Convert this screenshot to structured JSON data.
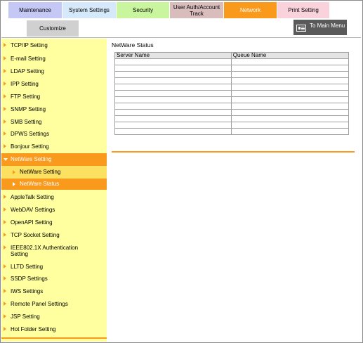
{
  "tabs": {
    "maintenance": "Maintenance",
    "system_settings": "System Settings",
    "security": "Security",
    "user_auth_line1": "User Auth/Account",
    "user_auth_line2": "Track",
    "network": "Network",
    "print_setting": "Print Setting",
    "customize": "Customize"
  },
  "main_menu_label": "To Main Menu",
  "sidebar": {
    "items": [
      "TCP/IP Setting",
      "E-mail Setting",
      "LDAP Setting",
      "IPP Setting",
      "FTP Setting",
      "SNMP Setting",
      "SMB Setting",
      "DPWS Settings",
      "Bonjour Setting",
      "NetWare Setting",
      "NetWare Setting",
      "NetWare Status",
      "AppleTalk Setting",
      "WebDAV Settings",
      "OpenAPI Setting",
      "TCP Socket Setting",
      "IEEE802.1X Authentication",
      "Setting",
      "LLTD Setting",
      "SSDP Settings",
      "IWS Settings",
      "Remote Panel Settings",
      "JSP Setting",
      "Hot Folder Setting"
    ]
  },
  "content": {
    "title": "NetWare Status",
    "columns": [
      "Server Name",
      "Queue Name"
    ]
  },
  "colors": {
    "accent": "#f99a1c",
    "sidebar_bg": "#ffffa0",
    "sub_bg": "#fce060"
  }
}
